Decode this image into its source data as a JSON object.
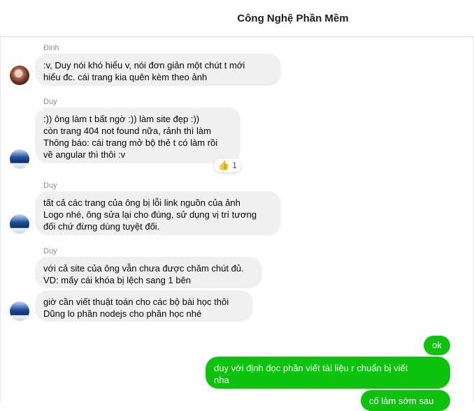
{
  "header": {
    "title": "Công Nghệ Phần Mềm"
  },
  "messages": [
    {
      "sender": "Định",
      "lines": [
        ":v, Duy nói khó hiểu v, nói đơn giản một chút t mới",
        "hiểu đc. cái trang kia quên kèm theo ảnh"
      ]
    },
    {
      "sender": "Duy",
      "lines": [
        ":)) ông làm t bất ngờ :)) làm site đẹp :))",
        "còn trang 404 not found nữa, rảnh thì làm",
        "Thông báo: cái trang mở bộ thẻ t có làm rồi",
        "về angular thì thôi :v"
      ],
      "reaction": {
        "emoji": "👍",
        "count": "1"
      }
    },
    {
      "sender": "Duy",
      "lines": [
        "tất cả các trang của ông bị lỗi link nguồn của ảnh",
        "Logo nhé, ông sửa lại cho đúng, sử dụng vị trí tương",
        "đối chứ đừng dùng tuyệt đối."
      ]
    },
    {
      "sender": "Duy",
      "lines": [
        "với cả site của ông vẫn chưa được chăm chút đủ.",
        "VD: mấy cái khóa bị lệch sang 1 bên"
      ]
    },
    {
      "sender": "",
      "lines": [
        "giờ cần viết thuật toán cho các bộ bài học thôi",
        "Dũng lo phần nodejs cho phần học nhé"
      ]
    }
  ],
  "outgoing": [
    {
      "lines": [
        "ok"
      ]
    },
    {
      "lines": [
        "duy với định đọc phần viết tài liệu r chuẩn bị viết",
        "nha"
      ]
    },
    {
      "lines": [
        "cố làm sớm sau"
      ]
    }
  ]
}
